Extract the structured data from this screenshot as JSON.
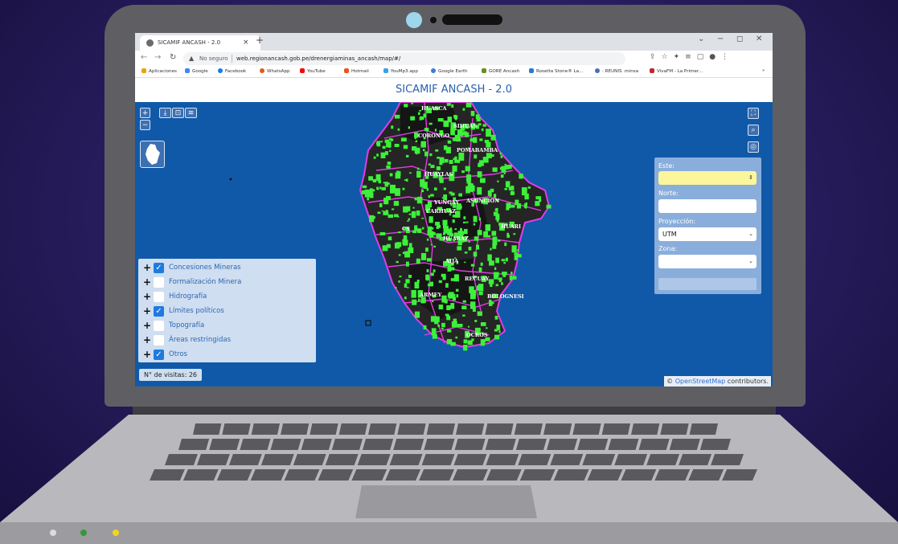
{
  "browser": {
    "tab_title": "SICAMIF ANCASH - 2.0",
    "tab_close": "×",
    "new_tab": "+",
    "window_controls": [
      "⌄",
      "−",
      "◻",
      "✕"
    ],
    "security_label": "No seguro",
    "url": "web.regionancash.gob.pe/drenergiaminas_ancash/map/#/",
    "bookmarks": [
      {
        "label": "Aplicaciones",
        "color": "#e8a317"
      },
      {
        "label": "Google",
        "color": "#4285f4"
      },
      {
        "label": "Facebook",
        "color": "#1877f2"
      },
      {
        "label": "WhatsApp",
        "color": "#e05a1a"
      },
      {
        "label": "YouTube",
        "color": "#ff0000"
      },
      {
        "label": "Hotmail",
        "color": "#f25022"
      },
      {
        "label": "YouMp3.app",
        "color": "#3aa0e8"
      },
      {
        "label": "Google Earth",
        "color": "#3b7dd8"
      },
      {
        "label": "GORE Ancash",
        "color": "#6b8e23"
      },
      {
        "label": "Rosetta Stone® La...",
        "color": "#2b78d0"
      },
      {
        "label": ": REUNIS :minsa",
        "color": "#4a6fb5"
      },
      {
        "label": "VivaFM - La Primer...",
        "color": "#c4262e"
      }
    ],
    "bookmarks_overflow": "»"
  },
  "app": {
    "title": "SICAMIF ANCASH - 2.0",
    "zoom_in": "+",
    "zoom_out": "−",
    "visits": "N° de visitas: 26",
    "attribution_prefix": "©",
    "attribution_link": "OpenStreetMap",
    "attribution_suffix": " contributors."
  },
  "map_labels": [
    "HUASCA",
    "SIHUAS",
    "CORONGO",
    "POMABAMBA",
    "HUAYLAS",
    "YUNGAY",
    "ASUNCION",
    "CARHUAZ",
    "HUARI",
    "HUARAZ",
    "AIJA",
    "RECUAY",
    "ARMEY",
    "BOLOGNESI",
    "OCROS",
    "CS"
  ],
  "layers": [
    {
      "label": "Concesiones Mineras",
      "checked": true
    },
    {
      "label": "Formalización Minera",
      "checked": false
    },
    {
      "label": "Hidrografía",
      "checked": false
    },
    {
      "label": "Límites políticos",
      "checked": true
    },
    {
      "label": "Topografía",
      "checked": false
    },
    {
      "label": "Áreas restringidas",
      "checked": false
    },
    {
      "label": "Otros",
      "checked": true
    }
  ],
  "coords": {
    "este_label": "Este:",
    "este_value": "",
    "norte_label": "Norte:",
    "norte_value": "",
    "proyeccion_label": "Proyección:",
    "proyeccion_value": "UTM",
    "zona_label": "Zona:",
    "zona_value": ""
  },
  "colors": {
    "map_background": "#1059a8",
    "boundary": "#e23ce6",
    "concession": "#3df03a",
    "title": "#2b5fae"
  }
}
